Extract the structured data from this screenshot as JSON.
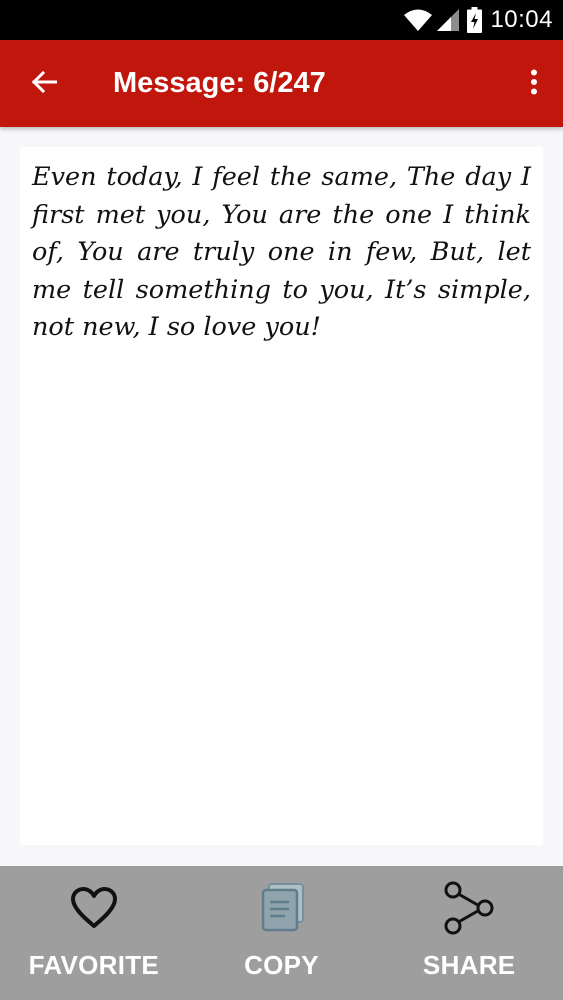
{
  "status_bar": {
    "time": "10:04",
    "icons": [
      "wifi-icon",
      "signal-icon",
      "battery-charging-icon"
    ]
  },
  "app_bar": {
    "title": "Message: 6/247",
    "back_icon": "arrow-left-icon",
    "overflow_icon": "more-vertical-icon"
  },
  "message": {
    "text": "Even today, I feel the same, The day I first met you, You are the one I think of, You are truly one in few, But, let me tell something to you, It’s simple, not new, I so love you!"
  },
  "bottom_bar": {
    "actions": [
      {
        "label": "FAVORITE",
        "icon": "heart-outline-icon"
      },
      {
        "label": "COPY",
        "icon": "copy-icon"
      },
      {
        "label": "SHARE",
        "icon": "share-icon"
      }
    ]
  },
  "colors": {
    "app_bar": "#c0160c",
    "status_bar": "#000000",
    "background": "#f7f6f8",
    "bottom_bar": "#9e9e9e",
    "copy_icon_fill": "#90a4ae",
    "copy_icon_stroke": "#607d8b"
  }
}
